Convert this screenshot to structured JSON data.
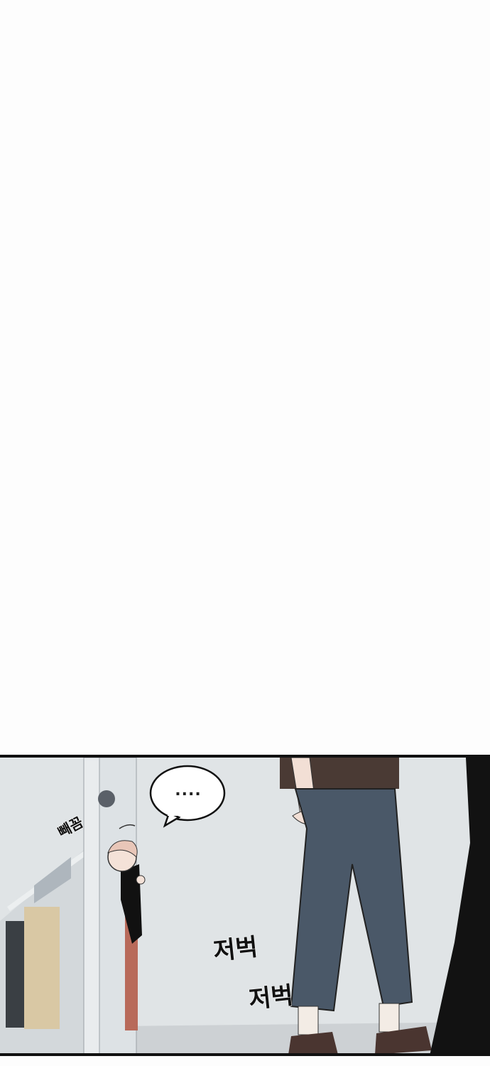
{
  "panel": {
    "speech_bubble_text": "....",
    "sfx_peek": "빼꼼",
    "sfx_step_1": "저벅",
    "sfx_step_2": "저벅"
  },
  "colors": {
    "background": "#fdfdfd",
    "wall": "#dfe3e5",
    "floor": "#cfd3d6",
    "pants": "#4a5868",
    "shirt": "#4a3a34",
    "skin": "#f2dfd5",
    "hair": "#e8c6b8",
    "black": "#111111"
  }
}
